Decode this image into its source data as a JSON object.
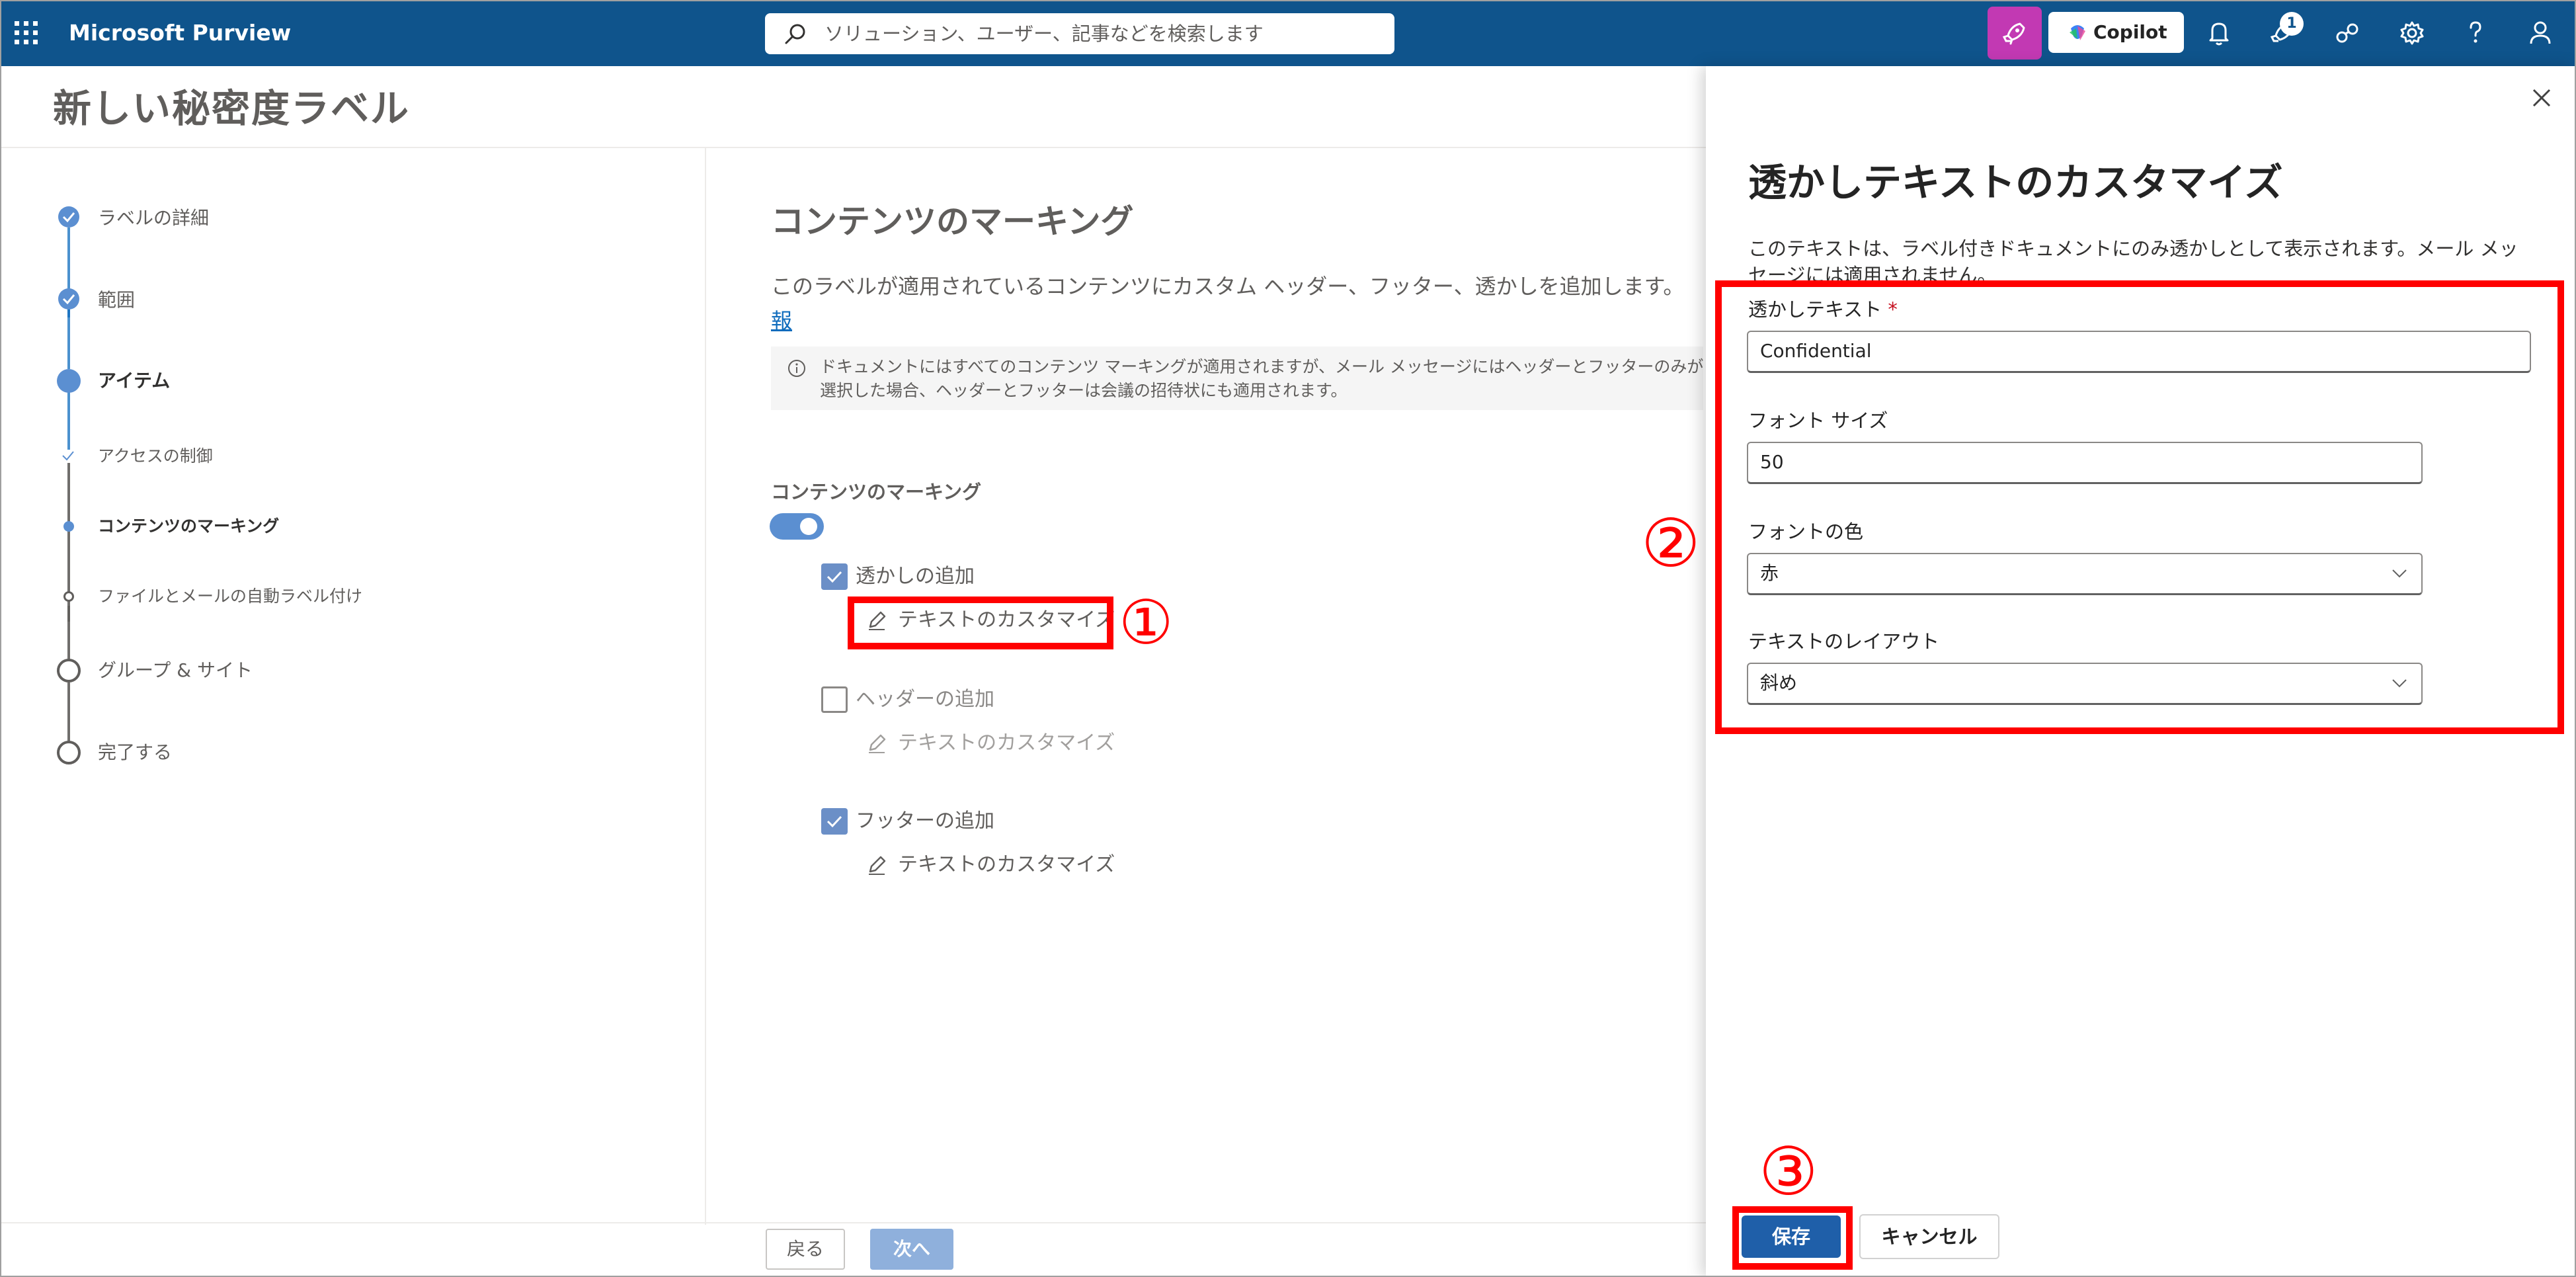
{
  "app": {
    "name": "Microsoft Purview"
  },
  "topbar": {
    "search_placeholder": "ソリューション、ユーザー、記事などを検索します",
    "copilot_label": "Copilot",
    "notification_badge": "1",
    "icons": [
      "waffle-icon",
      "search-icon",
      "copilot-icon",
      "bell-icon",
      "rocket-icon",
      "share-icon",
      "gear-icon",
      "help-icon",
      "person-icon"
    ]
  },
  "page": {
    "title": "新しい秘密度ラベル"
  },
  "wizard": {
    "steps": [
      {
        "label": "ラベルの詳細",
        "state": "done"
      },
      {
        "label": "範囲",
        "state": "done"
      },
      {
        "label": "アイテム",
        "state": "current"
      },
      {
        "label": "アクセスの制御",
        "state": "sub-done"
      },
      {
        "label": "コンテンツのマーキング",
        "state": "sub-current"
      },
      {
        "label": "ファイルとメールの自動ラベル付け",
        "state": "sub-pending"
      },
      {
        "label": "グループ & サイト",
        "state": "pending"
      },
      {
        "label": "完了する",
        "state": "pending"
      }
    ]
  },
  "content": {
    "heading": "コンテンツのマーキング",
    "description": "このラベルが適用されているコンテンツにカスタム ヘッダー、フッター、透かしを追加します。",
    "info_link": "報",
    "info_line1": "ドキュメントにはすべてのコンテンツ マーキングが適用されますが、メール メッセージにはヘッダーとフッターのみが適用",
    "info_line2": "選択した場合、ヘッダーとフッターは会議の招待状にも適用されます。",
    "marking_label": "コンテンツのマーキング",
    "toggle_on": true,
    "options": [
      {
        "label": "透かしの追加",
        "checked": true,
        "customize": "テキストのカスタマイズ"
      },
      {
        "label": "ヘッダーの追加",
        "checked": false,
        "customize": "テキストのカスタマイズ"
      },
      {
        "label": "フッターの追加",
        "checked": true,
        "customize": "テキストのカスタマイズ"
      }
    ]
  },
  "footer": {
    "back": "戻る",
    "next": "次へ"
  },
  "panel": {
    "title": "透かしテキストのカスタマイズ",
    "description": "このテキストは、ラベル付きドキュメントにのみ透かしとして表示されます。メール メッセージには適用されません。",
    "fields": {
      "watermark_label": "透かしテキスト",
      "required_mark": "*",
      "watermark_value": "Confidential",
      "font_size_label": "フォント サイズ",
      "font_size_value": "50",
      "font_color_label": "フォントの色",
      "font_color_value": "赤",
      "layout_label": "テキストのレイアウト",
      "layout_value": "斜め"
    },
    "save": "保存",
    "cancel": "キャンセル"
  },
  "annotations": {
    "marker1": "①",
    "marker2": "②",
    "marker3": "③",
    "color": "#ff0000"
  },
  "colors": {
    "topbar": "#0f548c",
    "accent": "#0f6cbd",
    "copilot_tile": "#c239b3"
  }
}
